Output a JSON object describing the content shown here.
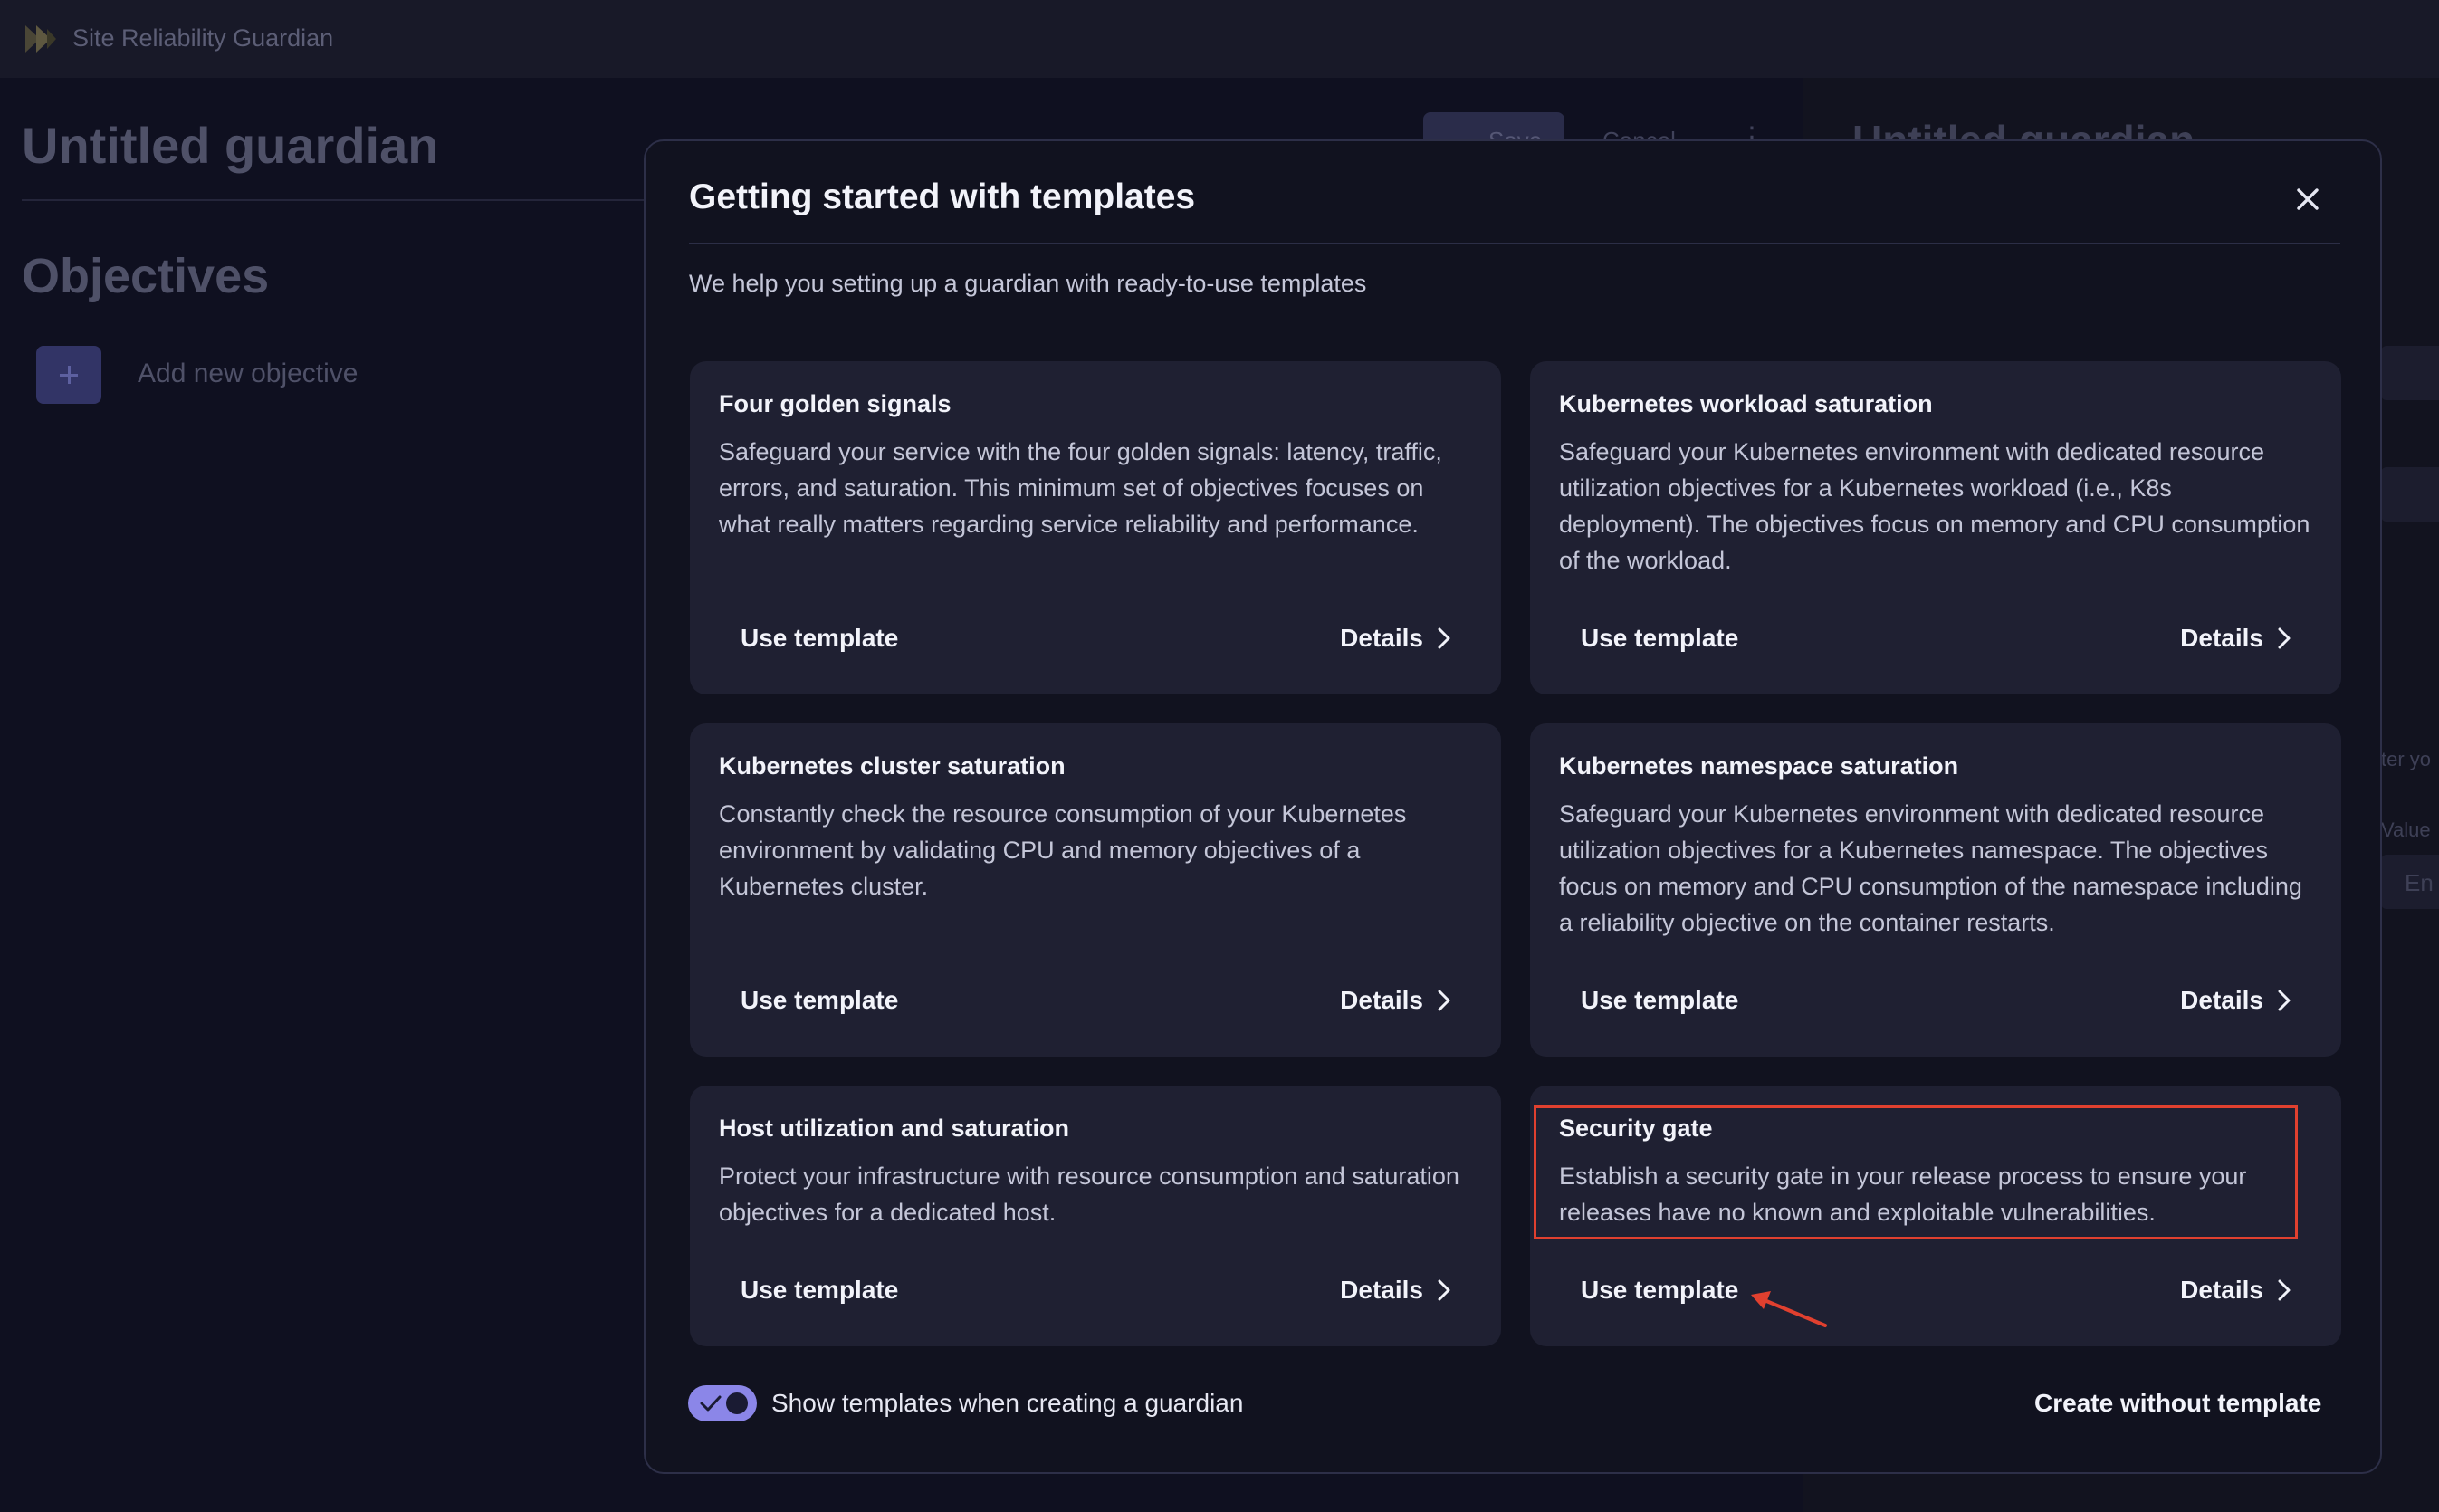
{
  "app": {
    "title": "Site Reliability Guardian",
    "guardian_title": "Untitled guardian",
    "objectives_heading": "Objectives",
    "add_objective_label": "Add new objective",
    "save_label": "Save",
    "cancel_label": "Cancel",
    "more_label": "⋮",
    "right_title": "Untitled guardian",
    "right_hint": "ter yo",
    "right_value_label": "Value",
    "right_value_placeholder": "En"
  },
  "modal": {
    "title": "Getting started with templates",
    "subtitle": "We help you setting up a guardian with ready-to-use templates",
    "use_label": "Use template",
    "details_label": "Details",
    "cards": [
      {
        "title": "Four golden signals",
        "description": "Safeguard your service with the four golden signals: latency, traffic, errors, and saturation. This minimum set of objectives focuses on what really matters regarding service reliability and performance."
      },
      {
        "title": "Kubernetes workload saturation",
        "description": "Safeguard your Kubernetes environment with dedicated resource utilization objectives for a Kubernetes workload (i.e., K8s deployment). The objectives focus on memory and CPU consumption of the workload."
      },
      {
        "title": "Kubernetes cluster saturation",
        "description": "Constantly check the resource consumption of your Kubernetes environment by validating CPU and memory objectives of a Kubernetes cluster."
      },
      {
        "title": "Kubernetes namespace saturation",
        "description": "Safeguard your Kubernetes environment with dedicated resource utilization objectives for a Kubernetes namespace. The objectives focus on memory and CPU consumption of the namespace including a reliability objective on the container restarts."
      },
      {
        "title": "Host utilization and saturation",
        "description": "Protect your infrastructure with resource consumption and saturation objectives for a dedicated host."
      },
      {
        "title": "Security gate",
        "description": "Establish a security gate in your release process to ensure your releases have no known and exploitable vulnerabilities."
      }
    ],
    "toggle_label": "Show templates when creating a guardian",
    "toggle_on": true,
    "create_without_label": "Create without template"
  },
  "colors": {
    "accent": "#8b86e8",
    "highlight": "#e0402f"
  },
  "icons": [
    "app-logo-icon",
    "close-icon",
    "chevron-right-icon",
    "check-icon",
    "plus-icon"
  ]
}
